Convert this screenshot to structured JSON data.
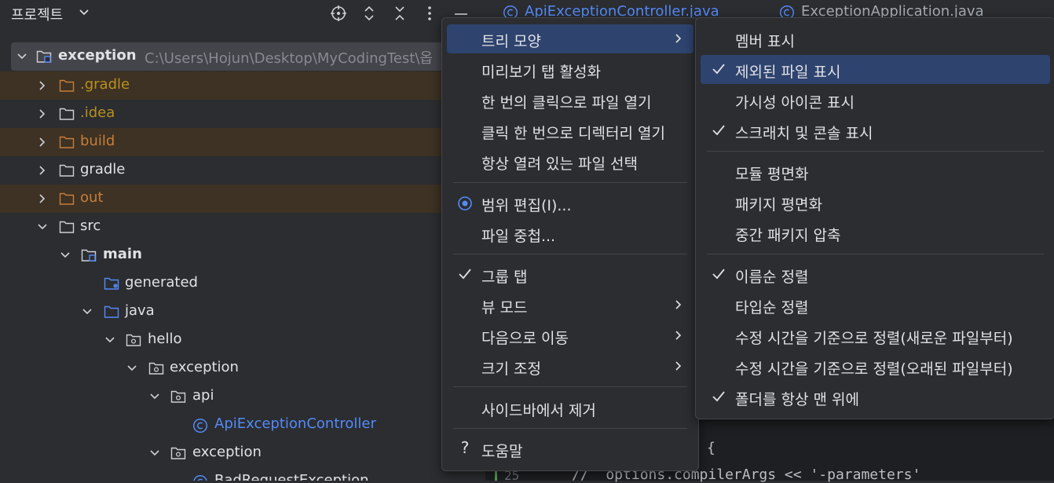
{
  "panel": {
    "title": "프로젝트",
    "header_icons": [
      "crosshair-icon",
      "expand-collapse-icon",
      "collapse-all-icon",
      "more-vertical-icon",
      "hide-icon"
    ]
  },
  "editor": {
    "tabs": [
      "ApiExceptionController.java",
      "ExceptionApplication.java"
    ],
    "code": [
      "{",
      "//  options.compilerArgs << '-parameters'"
    ],
    "line_numbers": [
      "25"
    ]
  },
  "tree": {
    "root": {
      "name": "exception",
      "path": "C:\\Users\\Hojun\\Desktop\\MyCodingTest\\옵"
    },
    "items": [
      {
        "label": ".gradle"
      },
      {
        "label": ".idea"
      },
      {
        "label": "build"
      },
      {
        "label": "gradle"
      },
      {
        "label": "out"
      },
      {
        "label": "src"
      },
      {
        "label": "main"
      },
      {
        "label": "generated"
      },
      {
        "label": "java"
      },
      {
        "label": "hello"
      },
      {
        "label": "exception"
      },
      {
        "label": "api"
      },
      {
        "label": "ApiExceptionController"
      },
      {
        "label": "exception"
      },
      {
        "label": "BadRequestException"
      }
    ]
  },
  "main_menu": {
    "items": [
      {
        "label": "트리 모양"
      },
      {
        "label": "미리보기 탭 활성화"
      },
      {
        "label": "한 번의 클릭으로 파일 열기"
      },
      {
        "label": "클릭 한 번으로 디렉터리 열기"
      },
      {
        "label": "항상 열려 있는 파일 선택"
      },
      {
        "label": "범위 편집(I)..."
      },
      {
        "label": "파일 중첩..."
      },
      {
        "label": "그룹 탭"
      },
      {
        "label": "뷰 모드"
      },
      {
        "label": "다음으로 이동"
      },
      {
        "label": "크기 조정"
      },
      {
        "label": "사이드바에서 제거"
      },
      {
        "label": "도움말"
      }
    ]
  },
  "sub_menu": {
    "items": [
      {
        "label": "멤버 표시"
      },
      {
        "label": "제외된 파일 표시"
      },
      {
        "label": "가시성 아이콘 표시"
      },
      {
        "label": "스크래치 및 콘솔 표시"
      },
      {
        "label": "모듈 평면화"
      },
      {
        "label": "패키지 평면화"
      },
      {
        "label": "중간 패키지 압축"
      },
      {
        "label": "이름순 정렬"
      },
      {
        "label": "타입순 정렬"
      },
      {
        "label": "수정 시간을 기준으로 정렬(새로운 파일부터)"
      },
      {
        "label": "수정 시간을 기준으로 정렬(오래된 파일부터)"
      },
      {
        "label": "폴더를 항상 맨 위에"
      }
    ]
  },
  "colors": {
    "excluded_folder": "#c77d3b",
    "excluded_row_bg": "#3d3223",
    "selection": "#2e436e",
    "class_blue": "#548af7"
  }
}
